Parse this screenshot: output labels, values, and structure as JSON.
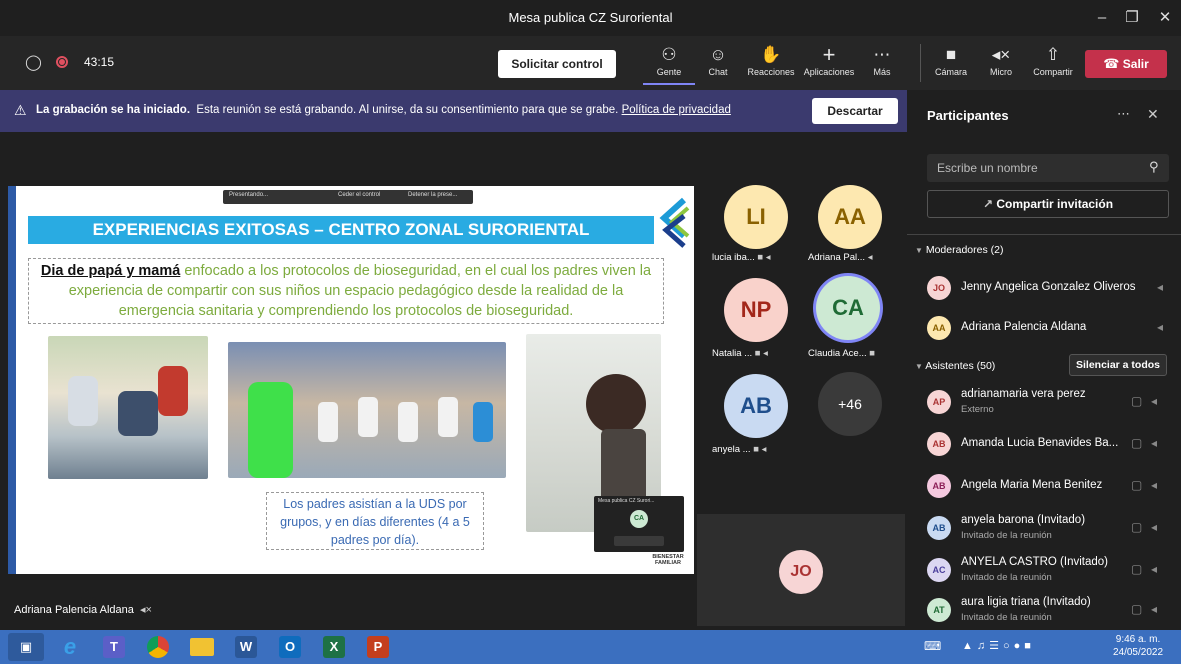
{
  "window": {
    "title": "Mesa publica CZ Suroriental"
  },
  "toolbar": {
    "timer": "43:15",
    "request_control": "Solicitar control",
    "buttons": [
      {
        "label": "Gente",
        "icon": "people-icon"
      },
      {
        "label": "Chat",
        "icon": "chat-icon"
      },
      {
        "label": "Reacciones",
        "icon": "reactions-icon"
      },
      {
        "label": "Aplicaciones",
        "icon": "plus-icon"
      },
      {
        "label": "Más",
        "icon": "more-icon"
      },
      {
        "label": "Cámara",
        "icon": "camera-off-icon"
      },
      {
        "label": "Micro",
        "icon": "mic-off-icon"
      },
      {
        "label": "Compartir",
        "icon": "share-icon"
      }
    ],
    "leave": "Salir",
    "leave_color": "#c4314b"
  },
  "banner": {
    "bold": "La grabación se ha iniciado.",
    "text": "Esta reunión se está grabando. Al unirse, da su consentimiento para que se grabe.",
    "link": "Política de privacidad",
    "dismiss": "Descartar"
  },
  "slide": {
    "title": "EXPERIENCIAS EXITOSAS – CENTRO ZONAL SURORIENTAL",
    "lead": "Dia de papá y mamá",
    "body": "enfocado a los protocolos de bioseguridad, en el cual los padres viven la experiencia de compartir con sus niños un espacio pedagógico desde la realidad de la emergencia sanitaria y comprendiendo los protocolos de bioseguridad.",
    "caption": "Los padres asistían a la UDS por grupos, y en días diferentes (4 a 5 padres por día).",
    "mini_title": "Mesa publica CZ Surori...",
    "mini_avatar": "CA",
    "mini_toolbar_items": [
      "Presentando...",
      "Ceder el control",
      "Detener la prese..."
    ],
    "brand": "BIENESTAR FAMILIAR"
  },
  "presenter_name": "Adriana Palencia Aldana",
  "tiles": [
    {
      "initials": "LI",
      "name": "lucia iba...",
      "bg": "#fde8b0",
      "fg": "#8a6100"
    },
    {
      "initials": "AA",
      "name": "Adriana Pal...",
      "bg": "#fde8b0",
      "fg": "#8a6100"
    },
    {
      "initials": "NP",
      "name": "Natalia ...",
      "bg": "#f9d2cb",
      "fg": "#a3271a"
    },
    {
      "initials": "CA",
      "name": "Claudia Ace...",
      "bg": "#cde9d3",
      "fg": "#1f6b35"
    },
    {
      "initials": "AB",
      "name": "anyela ...",
      "bg": "#c9daf2",
      "fg": "#1f4e8c"
    },
    {
      "initials": "+46",
      "name": "",
      "bg": "#3a3a3a",
      "fg": "#ffffff"
    },
    {
      "initials": "JO",
      "name": "",
      "bg": "#f7d5d5",
      "fg": "#a33"
    }
  ],
  "panel": {
    "title": "Participantes",
    "search_placeholder": "Escribe un nombre",
    "share_invite": "Compartir invitación",
    "moderators_header": "Moderadores (2)",
    "attendees_header": "Asistentes (50)",
    "mute_all": "Silenciar a todos",
    "moderators": [
      {
        "initials": "JO",
        "name": "Jenny Angelica Gonzalez Oliveros",
        "bg": "#f7d5d5",
        "fg": "#a33"
      },
      {
        "initials": "AA",
        "name": "Adriana Palencia Aldana",
        "bg": "#fde8b0",
        "fg": "#8a6100"
      }
    ],
    "attendees": [
      {
        "initials": "AP",
        "name": "adrianamaria vera perez",
        "sub": "Externo",
        "bg": "#f7d5d5",
        "fg": "#a33"
      },
      {
        "initials": "AB",
        "name": "Amanda Lucia Benavides Ba...",
        "sub": "",
        "bg": "#f7d5d5",
        "fg": "#a33"
      },
      {
        "initials": "AB",
        "name": "Angela Maria Mena Benitez",
        "sub": "",
        "bg": "#f4c9df",
        "fg": "#8c1f57"
      },
      {
        "initials": "AB",
        "name": "anyela barona (Invitado)",
        "sub": "Invitado de la reunión",
        "bg": "#c9daf2",
        "fg": "#1f4e8c"
      },
      {
        "initials": "AC",
        "name": "ANYELA CASTRO (Invitado)",
        "sub": "Invitado de la reunión",
        "bg": "#dcd7f2",
        "fg": "#4b3f9c"
      },
      {
        "initials": "AT",
        "name": "aura ligia triana (Invitado)",
        "sub": "Invitado de la reunión",
        "bg": "#cde9d3",
        "fg": "#1f6b35"
      }
    ]
  },
  "taskbar": {
    "apps": [
      {
        "label": "",
        "icon": "task-view-icon",
        "bg": "#2e5a9c"
      },
      {
        "label": "e",
        "icon": "edge-icon",
        "bg": "transparent"
      },
      {
        "label": "T",
        "icon": "teams-icon",
        "bg": "#5b5fc7"
      },
      {
        "label": "",
        "icon": "chrome-icon",
        "bg": "transparent"
      },
      {
        "label": "",
        "icon": "folder-icon",
        "bg": "transparent"
      },
      {
        "label": "W",
        "icon": "word-icon",
        "bg": "#2b5797"
      },
      {
        "label": "O",
        "icon": "outlook-icon",
        "bg": "#0f6cbd"
      },
      {
        "label": "X",
        "icon": "excel-icon",
        "bg": "#1e7145"
      },
      {
        "label": "P",
        "icon": "powerpoint-icon",
        "bg": "#c43e1c"
      }
    ],
    "time": "9:46 a. m.",
    "date": "24/05/2022"
  }
}
